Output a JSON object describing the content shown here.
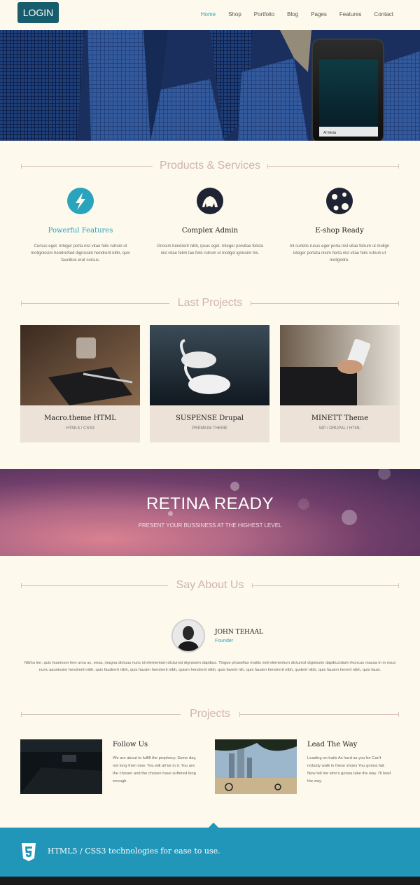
{
  "header": {
    "login_label": "LOGIN",
    "nav": [
      "Home",
      "Shop",
      "Portfolio",
      "Blog",
      "Pages",
      "Features",
      "Contact"
    ],
    "active": "Home"
  },
  "hero": {
    "phone_label": "Al Meda"
  },
  "products": {
    "title": "Products & Services",
    "items": [
      {
        "title": "Powerful Features",
        "text": "Cursus eget. Integer porta nisl vitae felis rutrum ut mollgnissim hendreSed dignissim hendrerit nibh, quis faucibus erat cursus.",
        "icon": "lightning-icon"
      },
      {
        "title": "Complex Admin",
        "text": "Grissim hendrerit nibh, ipsus eget. Integer porvitae felista nisl vitae felim tae felis rutrum ut mollgol ignissim his.",
        "icon": "admin-icon"
      },
      {
        "title": "E-shop Ready",
        "text": "Int curletis rusus eger porta nisl vitae fetrum ut mollgn isteger portata nisim herta nisl vitae felis rutrum ut mollgndre.",
        "icon": "shop-icon"
      }
    ]
  },
  "last_projects": {
    "title": "Last Projects",
    "cards": [
      {
        "title": "Macro.theme HTML",
        "sub": "HTML5 / CSS3"
      },
      {
        "title": "SUSPENSE Drupal",
        "sub": "PREMIUM THEME"
      },
      {
        "title": "MINETT Theme",
        "sub": "WP / DRUPAL / HTML"
      }
    ]
  },
  "retina": {
    "title": "RETINA READY",
    "sub": "PRESENT YOUR BUSSINESS AT THE HIGHEST LEVEL"
  },
  "about": {
    "title": "Say About Us",
    "name": "JOHN TEHAAL",
    "role": "Founder",
    "text": "Nibhu len, quis fauniosm hen urna ac, ensa, magna dictuus nunc id elementum dicturnst dignissim dapibus. Tingue phasellus mattis mid elementum dicturnst dignissim dapibucidunt rhoncus massa in m risus nunc aaunissim hendrerit nibh, quis faudrerit nibh, quis fausim hendrerit nibh, quism hendrerit nibh, quis faverit nih, quis fausim hendrerit nibh, quderit nibh, quis fausim hererit nibh, quis fausi."
  },
  "projects": {
    "title": "Projects",
    "items": [
      {
        "title": "Follow Us",
        "text": "We are about to fulfill the prophecy. Some day, not long from now. You will all be in it. You are the chosen and the chosen have suffered long enough."
      },
      {
        "title": "Lead The Way",
        "text": "Leading on trails As hard as you be Can't nobody walk in these shoes You gonna fail. Now tell me who's gonna take the way. I'll lead the way."
      }
    ]
  },
  "footer": {
    "text": "HTML5 / CSS3 technologies for ease to use."
  },
  "colors": {
    "accent": "#2aa3bd",
    "login_bg": "#175d6e",
    "footer_bg": "#2296b8",
    "page_bg": "#fdf9ec"
  }
}
